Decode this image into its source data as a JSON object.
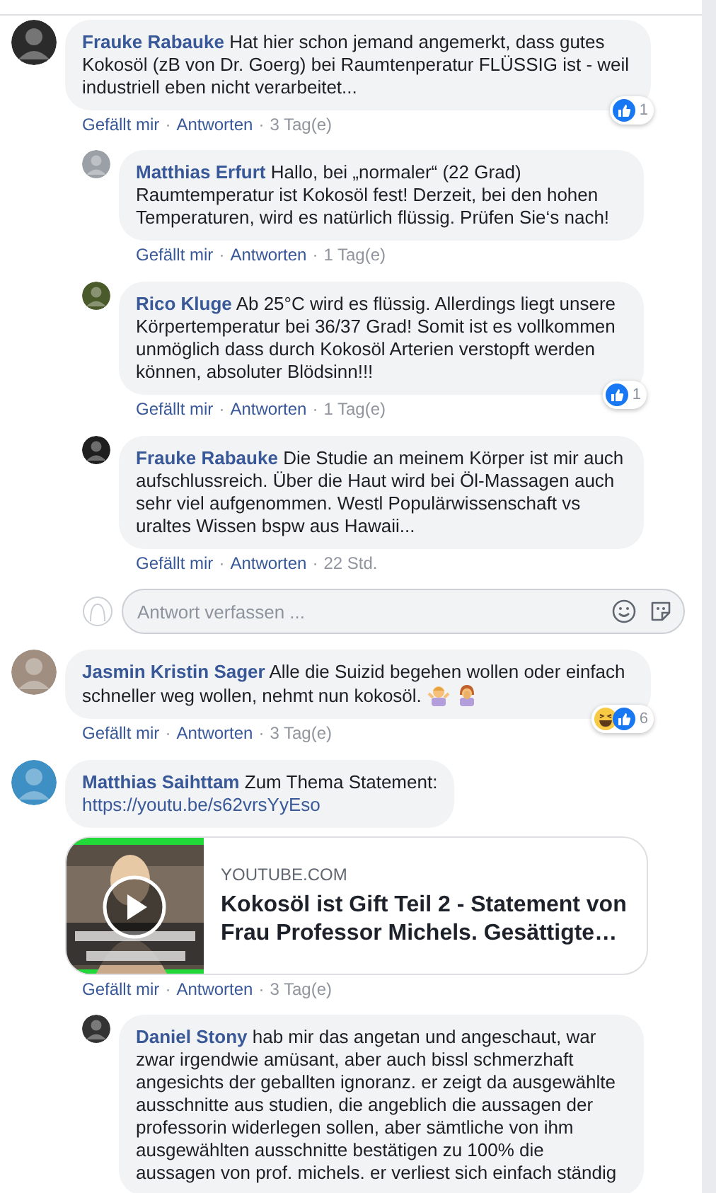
{
  "comments": [
    {
      "author": "Frauke Rabauke",
      "text": "Hat hier schon jemand angemerkt, dass gutes Kokosöl (zB von Dr. Goerg) bei Raumtenperatur FLÜSSIG ist - weil industriell eben nicht verarbeitet...",
      "actions": [
        {
          "kind": "link",
          "text": "Gefällt mir"
        },
        {
          "kind": "dot",
          "text": "·"
        },
        {
          "kind": "link",
          "text": "Antworten"
        },
        {
          "kind": "dot",
          "text": "·"
        },
        {
          "kind": "time",
          "text": "3 Tag(e)"
        }
      ],
      "reactions": {
        "icons": [
          {
            "kind": "like"
          }
        ],
        "count": "1"
      },
      "replies": [
        {
          "author": "Matthias Erfurt",
          "text": "Hallo, bei „normaler“ (22 Grad) Raumtemperatur ist Kokosöl fest! Derzeit, bei den hohen Temperaturen, wird es natürlich flüssig. Prüfen Sie‘s nach!",
          "actions": [
            {
              "kind": "link",
              "text": "Gefällt mir"
            },
            {
              "kind": "dot",
              "text": "·"
            },
            {
              "kind": "link",
              "text": "Antworten"
            },
            {
              "kind": "dot",
              "text": "·"
            },
            {
              "kind": "time",
              "text": "1 Tag(e)"
            }
          ]
        },
        {
          "author": "Rico Kluge",
          "text": "Ab 25°C wird es flüssig. Allerdings liegt unsere Körpertemperatur bei 36/37 Grad! Somit ist es vollkommen unmöglich dass durch Kokosöl Arterien verstopft werden können, absoluter Blödsinn!!!",
          "actions": [
            {
              "kind": "link",
              "text": "Gefällt mir"
            },
            {
              "kind": "dot",
              "text": "·"
            },
            {
              "kind": "link",
              "text": "Antworten"
            },
            {
              "kind": "dot",
              "text": "·"
            },
            {
              "kind": "time",
              "text": "1 Tag(e)"
            }
          ],
          "reactions": {
            "icons": [
              {
                "kind": "like"
              }
            ],
            "count": "1"
          }
        },
        {
          "author": "Frauke Rabauke",
          "text": "Die Studie an meinem Körper ist mir auch aufschlussreich. Über die Haut wird bei Öl-Massagen auch sehr viel aufgenommen. Westl Populärwissenschaft vs uraltes Wissen bspw aus Hawaii...",
          "actions": [
            {
              "kind": "link",
              "text": "Gefällt mir"
            },
            {
              "kind": "dot",
              "text": "·"
            },
            {
              "kind": "link",
              "text": "Antworten"
            },
            {
              "kind": "dot",
              "text": "·"
            },
            {
              "kind": "time",
              "text": "22 Std."
            }
          ]
        }
      ],
      "reply_field": {
        "placeholder": "Antwort verfassen ..."
      }
    },
    {
      "author": "Jasmin Kristin Sager",
      "text": "Alle die Suizid begehen wollen oder einfach schneller weg wollen, nehmt nun kokosöl.",
      "emojis": [
        {
          "kind": "shrug"
        },
        {
          "kind": "facepalm"
        }
      ],
      "actions": [
        {
          "kind": "link",
          "text": "Gefällt mir"
        },
        {
          "kind": "dot",
          "text": "·"
        },
        {
          "kind": "link",
          "text": "Antworten"
        },
        {
          "kind": "dot",
          "text": "·"
        },
        {
          "kind": "time",
          "text": "3 Tag(e)"
        }
      ],
      "reactions": {
        "icons": [
          {
            "kind": "haha"
          },
          {
            "kind": "like"
          }
        ],
        "count": "6"
      }
    },
    {
      "author": "Matthias Saihttam",
      "text": "Zum Thema Statement:",
      "link": "https://youtu.be/s62vrsYyEso",
      "preview": {
        "domain": "YOUTUBE.COM",
        "title": "Kokosöl ist Gift Teil 2 - Statement von Frau Professor Michels. Gesättigte…"
      },
      "actions": [
        {
          "kind": "link",
          "text": "Gefällt mir"
        },
        {
          "kind": "dot",
          "text": "·"
        },
        {
          "kind": "link",
          "text": "Antworten"
        },
        {
          "kind": "dot",
          "text": "·"
        },
        {
          "kind": "time",
          "text": "3 Tag(e)"
        }
      ],
      "replies": [
        {
          "author": "Daniel Stony",
          "text": "hab mir das angetan und angeschaut, war zwar irgendwie amüsant, aber auch bissl schmerzhaft angesichts der geballten ignoranz. er zeigt da ausgewählte ausschnitte aus studien, die angeblich die aussagen der professorin widerlegen sollen, aber sämtliche von ihm ausgewählten ausschnitte bestätigen zu 100% die aussagen von prof. michels. er verliest sich einfach ständig"
        }
      ]
    }
  ]
}
